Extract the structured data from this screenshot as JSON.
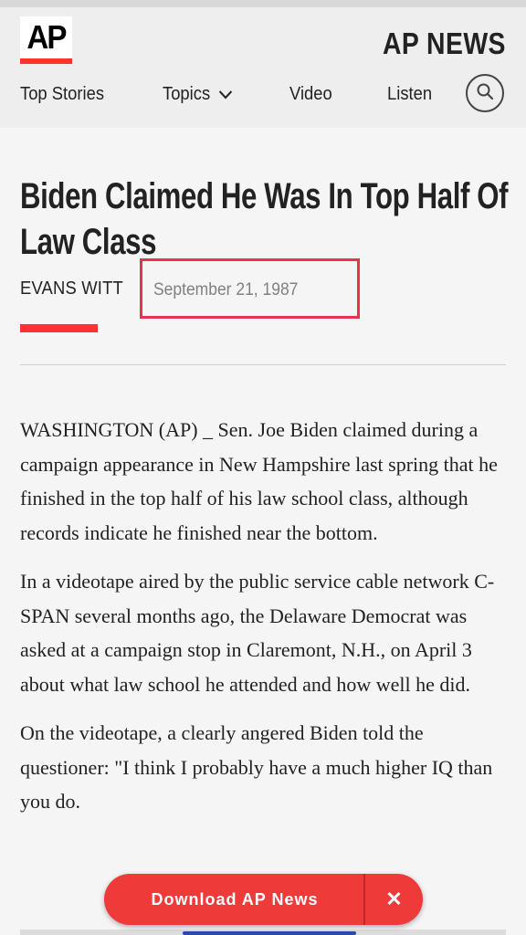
{
  "header": {
    "logo_text": "AP",
    "brand": "AP NEWS",
    "nav": [
      {
        "label": "Top Stories"
      },
      {
        "label": "Topics"
      },
      {
        "label": "Video"
      },
      {
        "label": "Listen"
      }
    ],
    "search_icon": "search-icon",
    "accent_color": "#ff322e"
  },
  "article": {
    "headline": "Biden Claimed He Was In Top Half Of Law Class",
    "author": "EVANS WITT",
    "date": "September 21, 1987",
    "paragraphs": [
      "WASHINGTON (AP) _ Sen. Joe Biden claimed during a campaign appearance in New Hampshire last spring that he finished in the top half of his law school class, although records indicate he finished near the bottom.",
      "In a videotape aired by the public service cable network C-SPAN several months ago, the Delaware Democrat was asked at a campaign stop in Claremont, N.H., on April 3 about what law school he attended and how well he did.",
      "On the videotape, a clearly angered Biden told the questioner: \"I think I probably have a much higher IQ than you do."
    ]
  },
  "banner": {
    "label": "Download AP News",
    "close": "✕",
    "color": "#ef3a3a"
  }
}
